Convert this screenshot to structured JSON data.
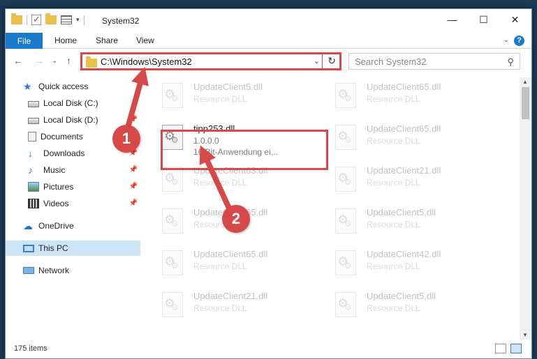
{
  "window": {
    "title": "System32",
    "minimize_glyph": "—",
    "maximize_glyph": "☐",
    "close_glyph": "✕"
  },
  "ribbon": {
    "tabs": [
      "File",
      "Home",
      "Share",
      "View"
    ],
    "help_glyph": "?",
    "expand_glyph": "⌄"
  },
  "nav": {
    "back_glyph": "←",
    "forward_glyph": "→",
    "recent_glyph": "⌄",
    "up_glyph": "↑"
  },
  "address": {
    "path": "C:\\Windows\\System32",
    "dropdown_glyph": "⌄",
    "refresh_glyph": "↻"
  },
  "search": {
    "placeholder": "Search System32",
    "icon_glyph": "⚲"
  },
  "sidebar": {
    "items": [
      {
        "label": "Quick access",
        "icon": "star-icon",
        "pinned": false
      },
      {
        "label": "Local Disk (C:)",
        "icon": "drive-icon",
        "pinned": false
      },
      {
        "label": "Local Disk (D:)",
        "icon": "drive-icon",
        "pinned": true
      },
      {
        "label": "Documents",
        "icon": "documents-icon",
        "pinned": true
      },
      {
        "label": "Downloads",
        "icon": "downloads-icon",
        "pinned": true
      },
      {
        "label": "Music",
        "icon": "music-icon",
        "pinned": true
      },
      {
        "label": "Pictures",
        "icon": "pictures-icon",
        "pinned": true
      },
      {
        "label": "Videos",
        "icon": "videos-icon",
        "pinned": true
      },
      {
        "label": "OneDrive",
        "icon": "cloud-icon",
        "pinned": false
      },
      {
        "label": "This PC",
        "icon": "computer-icon",
        "pinned": false,
        "selected": true
      },
      {
        "label": "Network",
        "icon": "network-icon",
        "pinned": false
      }
    ],
    "pin_glyph": "📌"
  },
  "files": [
    {
      "name": "UpdateClient5.dll",
      "line1": "Resource DLL",
      "line2": "",
      "faded": true
    },
    {
      "name": "UpdateClient65.dll",
      "line1": "Resource DLL",
      "line2": "",
      "faded": true
    },
    {
      "name": "tipp253.dll",
      "line1": "1.0.0.0",
      "line2": "16 Bit-Anwendung ei...",
      "faded": false
    },
    {
      "name": "UpdateClient65.dll",
      "line1": "Resource DLL",
      "line2": "",
      "faded": true
    },
    {
      "name": "UpdateClient63.dll",
      "line1": "Resource DLL",
      "line2": "",
      "faded": true
    },
    {
      "name": "UpdateClient21.dll",
      "line1": "Resource DLL",
      "line2": "",
      "faded": true
    },
    {
      "name": "UpdateClient65.dll",
      "line1": "Resource DLL",
      "line2": "",
      "faded": true
    },
    {
      "name": "UpdateClient5.dll",
      "line1": "Resource DLL",
      "line2": "",
      "faded": true
    },
    {
      "name": "UpdateClient65.dll",
      "line1": "Resource DLL",
      "line2": "",
      "faded": true
    },
    {
      "name": "UpdateClient42.dll",
      "line1": "Resource DLL",
      "line2": "",
      "faded": true
    },
    {
      "name": "UpdateClient21.dll",
      "line1": "Resource DLL",
      "line2": "",
      "faded": true
    },
    {
      "name": "UpdateClient5.dll",
      "line1": "Resource DLL",
      "line2": "",
      "faded": true
    }
  ],
  "status": {
    "item_count": "175 items"
  },
  "annotations": {
    "step1": "1",
    "step2": "2",
    "color": "#d74848"
  },
  "scroll": {
    "up_glyph": "▲",
    "down_glyph": "▼"
  }
}
